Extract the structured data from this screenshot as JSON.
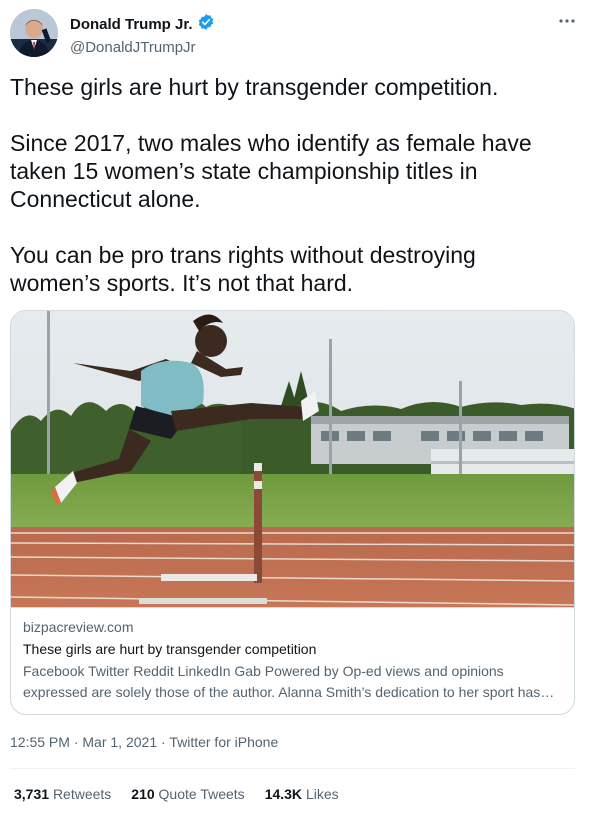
{
  "author": {
    "display_name": "Donald Trump Jr.",
    "handle": "@DonaldJTrumpJr",
    "verified_icon": "verified-badge-icon",
    "more_icon": "more-options-icon"
  },
  "tweet": {
    "paragraphs": [
      "These girls are hurt by transgender competition.",
      "Since 2017, two males who identify as female have taken 15 women’s state championship titles in Connecticut alone.",
      "You can be pro trans rights without destroying women’s sports. It’s not that hard."
    ]
  },
  "card": {
    "domain": "bizpacreview.com",
    "title": "These girls are hurt by transgender competition",
    "description": "Facebook Twitter Reddit LinkedIn Gab Powered by Op-ed views and opinions expressed are solely those of the author. Alanna Smith’s dedication to her sport has kept her busy over the last few years.",
    "image": "hurdler-on-track-photo"
  },
  "meta": {
    "time": "12:55 PM",
    "separator": "·",
    "date": "Mar 1, 2021",
    "source": "Twitter for iPhone"
  },
  "stats": {
    "retweets_count": "3,731",
    "retweets_label": "Retweets",
    "quotes_count": "210",
    "quotes_label": "Quote Tweets",
    "likes_count": "14.3K",
    "likes_label": "Likes"
  },
  "colors": {
    "text": "#0f1419",
    "secondary": "#536471",
    "verified": "#1d9bf0",
    "border": "#cfd9de"
  }
}
